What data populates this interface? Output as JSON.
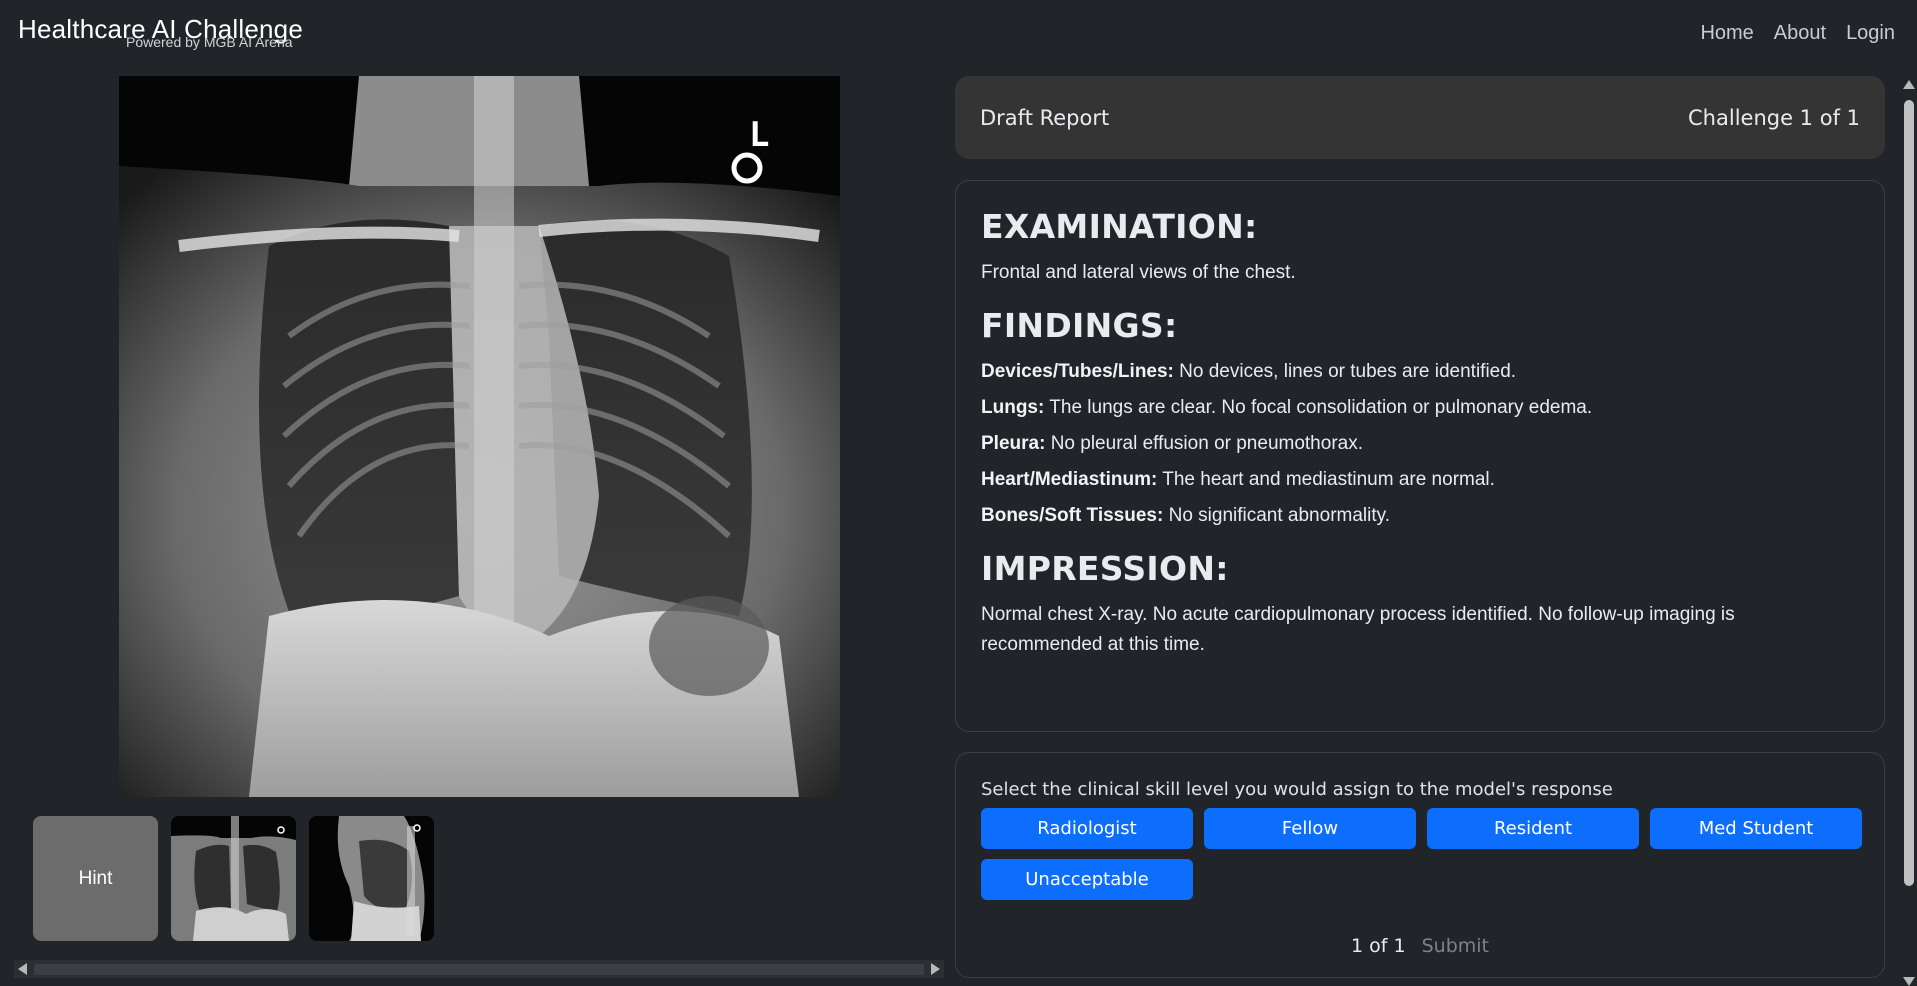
{
  "header": {
    "title": "Healthcare AI Challenge",
    "subtitle": "Powered by MGB AI Arena",
    "nav": [
      "Home",
      "About",
      "Login"
    ]
  },
  "viewer": {
    "hint_label": "Hint",
    "marker_letter": "L"
  },
  "draft": {
    "title": "Draft Report",
    "challenge": "Challenge 1 of 1"
  },
  "report": {
    "examination_heading": "EXAMINATION:",
    "examination_text": "Frontal and lateral views of the chest.",
    "findings_heading": "FINDINGS:",
    "findings": [
      {
        "label": "Devices/Tubes/Lines:",
        "text": "No devices, lines or tubes are identified."
      },
      {
        "label": "Lungs:",
        "text": "The lungs are clear. No focal consolidation or pulmonary edema."
      },
      {
        "label": "Pleura:",
        "text": "No pleural effusion or pneumothorax."
      },
      {
        "label": "Heart/Mediastinum:",
        "text": "The heart and mediastinum are normal."
      },
      {
        "label": "Bones/Soft Tissues:",
        "text": "No significant abnormality."
      }
    ],
    "impression_heading": "IMPRESSION:",
    "impression_text": "Normal chest X-ray. No acute cardiopulmonary process identified. No follow-up imaging is recommended at this time."
  },
  "skill": {
    "prompt": "Select the clinical skill level you would assign to the model's response",
    "options": [
      "Radiologist",
      "Fellow",
      "Resident",
      "Med Student",
      "Unacceptable"
    ],
    "page": "1 of 1",
    "submit_label": "Submit"
  },
  "colors": {
    "background": "#212529",
    "primary_button": "#0d6efd",
    "hint_button": "#6c6c6c",
    "draft_bar": "#343434"
  }
}
